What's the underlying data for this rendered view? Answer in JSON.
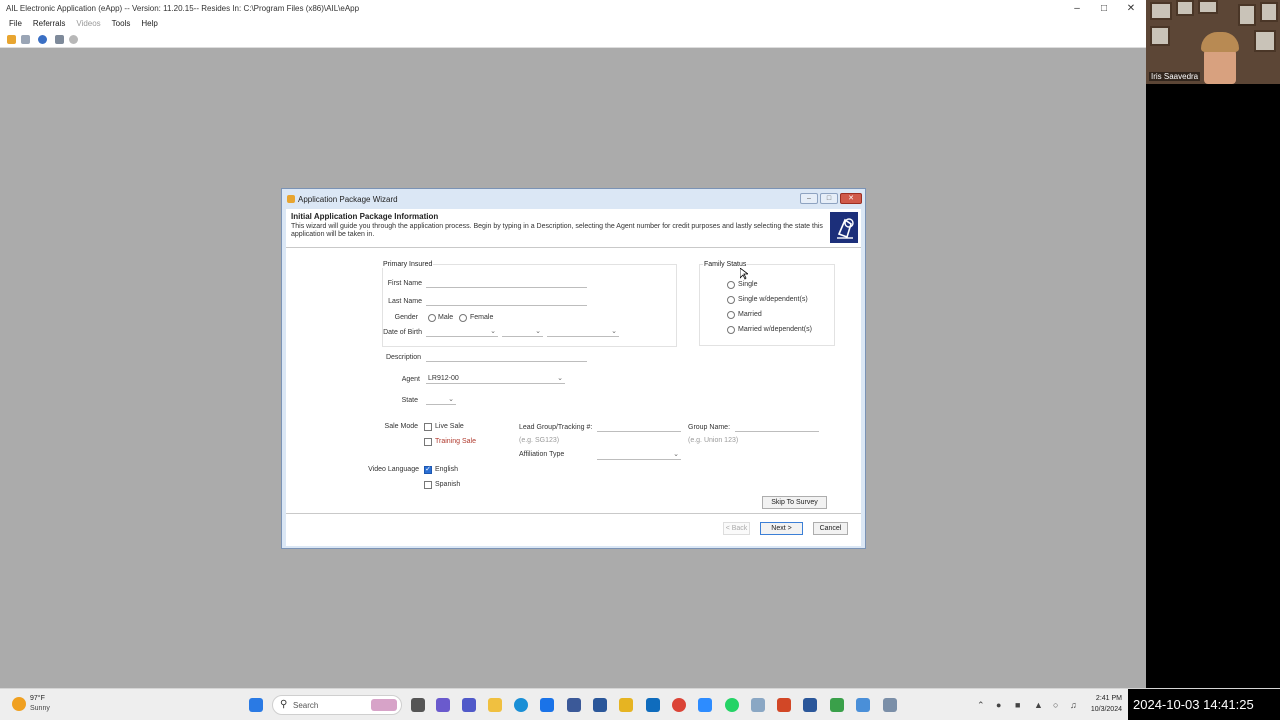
{
  "window": {
    "title": "AIL  Electronic Application (eApp) -- Version: 11.20.15-- Resides In: C:\\Program Files (x86)\\AIL\\eApp",
    "menu": [
      "File",
      "Referrals",
      "Videos",
      "Tools",
      "Help"
    ]
  },
  "video": {
    "participant_name": "Iris Saavedra"
  },
  "dialog": {
    "title": "Application Package Wizard",
    "header_title": "Initial Application Package Information",
    "header_desc": "This wizard will guide you through the application process.  Begin by typing in a Description, selecting the Agent number for credit purposes and lastly selecting the state this application will be taken in.",
    "primary_insured": {
      "label": "Primary Insured",
      "first_name_label": "First Name",
      "last_name_label": "Last Name",
      "gender_label": "Gender",
      "male": "Male",
      "female": "Female",
      "dob_label": "Date of Birth"
    },
    "family_status": {
      "label": "Family Status",
      "options": [
        "Single",
        "Single w/dependent(s)",
        "Married",
        "Married w/dependent(s)"
      ]
    },
    "description_label": "Description",
    "agent_label": "Agent",
    "agent_value": "LR912-00",
    "state_label": "State",
    "sale_mode_label": "Sale Mode",
    "live_sale": "Live Sale",
    "training_sale": "Training Sale",
    "lead_group_label": "Lead Group/Tracking #:",
    "lead_group_hint": "(e.g. SG123)",
    "group_name_label": "Group Name:",
    "group_name_hint": "(e.g. Union 123)",
    "affiliation_label": "Affiliation Type",
    "video_language_label": "Video Language",
    "english": "English",
    "spanish": "Spanish",
    "english_checked": true,
    "skip_to_survey": "Skip To Survey",
    "back": "< Back",
    "next": "Next >",
    "cancel": "Cancel"
  },
  "taskbar": {
    "weather_temp": "97°F",
    "weather_desc": "Sunny",
    "search_placeholder": "Search",
    "time": "2:41 PM",
    "date": "10/3/2024",
    "recording_timestamp": "2024-10-03  14:41:25"
  },
  "colors": {
    "accent": "#2b6fd4",
    "desktop": "#ababab",
    "dialog_frame": "#dbe7f5"
  }
}
